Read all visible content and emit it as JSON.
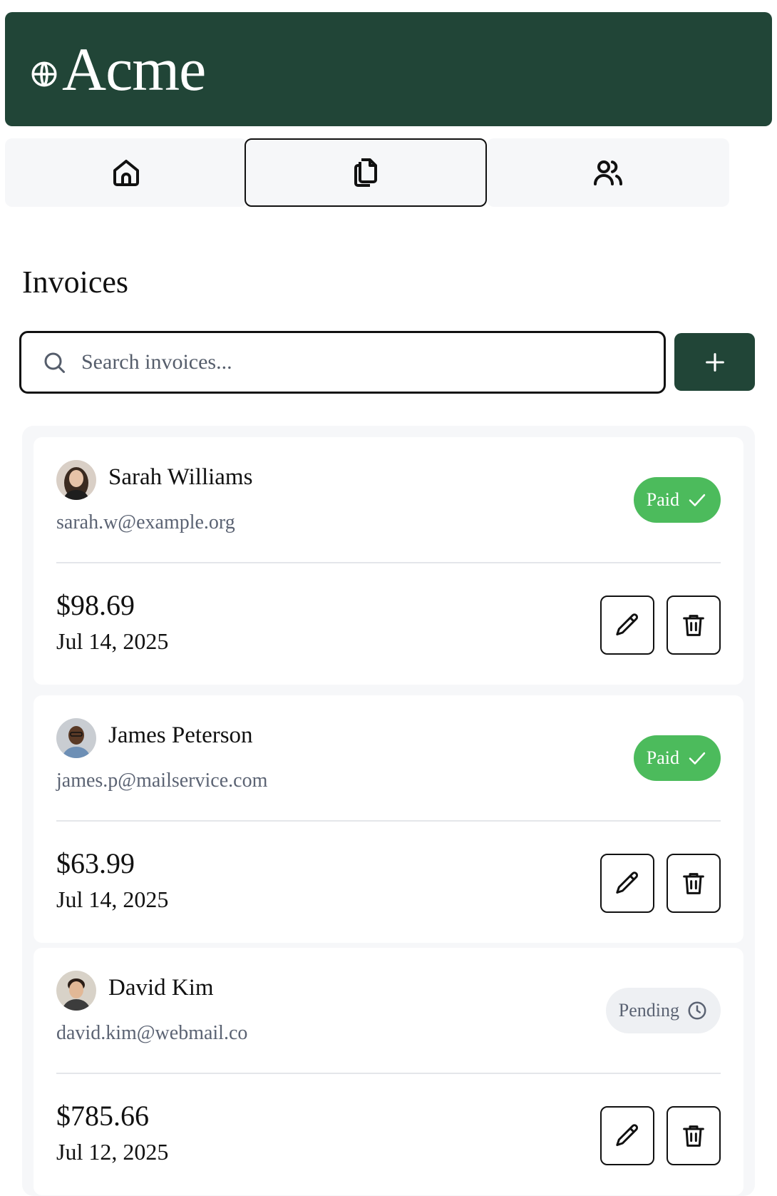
{
  "app": {
    "title": "Acme",
    "brand_color": "#214537"
  },
  "nav": {
    "tabs": [
      {
        "icon": "home-icon",
        "active": false
      },
      {
        "icon": "documents-icon",
        "active": true
      },
      {
        "icon": "users-icon",
        "active": false
      }
    ]
  },
  "page": {
    "title": "Invoices"
  },
  "search": {
    "placeholder": "Search invoices...",
    "value": ""
  },
  "invoices": [
    {
      "name": "Sarah Williams",
      "email": "sarah.w@example.org",
      "status": "Paid",
      "amount": "$98.69",
      "date": "Jul 14, 2025"
    },
    {
      "name": "James Peterson",
      "email": "james.p@mailservice.com",
      "status": "Paid",
      "amount": "$63.99",
      "date": "Jul 14, 2025"
    },
    {
      "name": "David Kim",
      "email": "david.kim@webmail.co",
      "status": "Pending",
      "amount": "$785.66",
      "date": "Jul 12, 2025"
    }
  ],
  "colors": {
    "paid": "#4cbb5c",
    "pending_bg": "#eef0f3",
    "muted_text": "#5b6373"
  }
}
